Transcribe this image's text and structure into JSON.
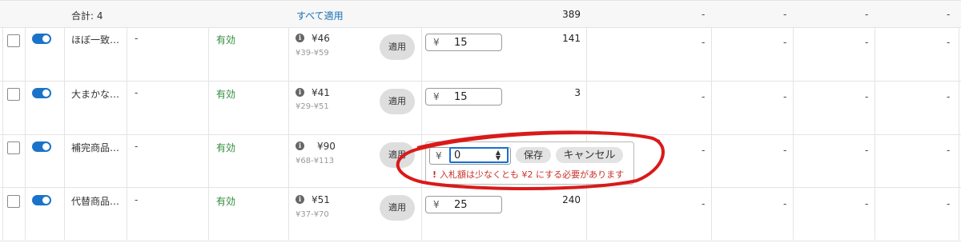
{
  "summary": {
    "total_label": "合計: 4",
    "apply_all": "すべて適用",
    "total_value": "389"
  },
  "rows": [
    {
      "name": "ほぼ一致…",
      "status": "有効",
      "price": "¥46",
      "range": "¥39-¥59",
      "apply": "適用",
      "bid_yen": "¥",
      "bid": "15",
      "value": "141"
    },
    {
      "name": "大まかな…",
      "status": "有効",
      "price": "¥41",
      "range": "¥29-¥51",
      "apply": "適用",
      "bid_yen": "¥",
      "bid": "15",
      "value": "3"
    },
    {
      "name": "補完商品…",
      "status": "有効",
      "price": "¥90",
      "range": "¥68-¥113",
      "apply": "適用",
      "bid_yen": "¥",
      "bid": "",
      "value": ""
    },
    {
      "name": "代替商品…",
      "status": "有効",
      "price": "¥51",
      "range": "¥37-¥70",
      "apply": "適用",
      "bid_yen": "¥",
      "bid": "25",
      "value": "240"
    }
  ],
  "dash": "-",
  "editor": {
    "yen": "¥",
    "value": "0",
    "save": "保存",
    "cancel": "キャンセル",
    "error": "入札額は少なくとも ¥2 にする必要があります",
    "error_mark": "!"
  },
  "icons": {
    "info": "info-icon",
    "toggle": "toggle-icon",
    "spinner": "spinner-icon"
  },
  "colors": {
    "accent": "#1a73c9",
    "valid": "#2e8b3a",
    "error": "#c9312b",
    "annotation": "#d91a1a"
  }
}
